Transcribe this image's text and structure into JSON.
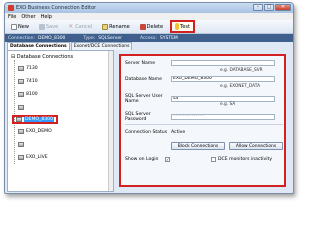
{
  "window": {
    "title": "EXO Business Connection Editor",
    "controls": {
      "minimize": "–",
      "maximize": "□",
      "close": "✕"
    }
  },
  "menu": {
    "items": [
      "File",
      "Other",
      "Help"
    ]
  },
  "toolbar": {
    "new_label": "New",
    "save_label": "Save",
    "cancel_label": "Cancel",
    "rename_label": "Rename",
    "delete_label": "Delete",
    "test_label": "Test"
  },
  "connection_bar": {
    "connection_label": "Connection:",
    "connection_value": "DEMO_8300",
    "type_label": "Type:",
    "type_value": "SQLServer",
    "access_label": "Access:",
    "access_value": "SYSTEM"
  },
  "tabs": [
    "Database Connections",
    "Exonet/DCE Connections"
  ],
  "tree": {
    "root_label": "Database Connections",
    "items": [
      "7130",
      "7410",
      "8100",
      "",
      "DEMO_8300",
      "EXO_DEMO",
      "",
      "EXO_LIVE"
    ],
    "selected_index": 4
  },
  "form": {
    "server_name_label": "Server Name",
    "server_name_value": "",
    "server_name_hint": "e.g. DATABASE_SVR",
    "database_name_label": "Database Name",
    "database_name_value": "EXO_DEMO_8300",
    "database_name_hint": "e.g. EXONET_DATA",
    "sql_user_label": "SQL Server User Name",
    "sql_user_value": "sa",
    "sql_user_hint": "e.g. SA",
    "sql_password_label": "SQL Server Password",
    "sql_password_value": "**************",
    "connection_status_label": "Connection Status",
    "connection_status_value": "Active",
    "block_button_label": "Block Connections",
    "allow_button_label": "Allow Connections",
    "show_on_login_label": "Show on Login",
    "show_on_login_checked": "✓",
    "dce_monitors_label": "DCE monitors inactivity",
    "dce_monitors_checked": ""
  },
  "colors": {
    "highlight_border": "#d32121",
    "connection_bar_bg": "#3f5f8c",
    "selection_bg": "#3399ff"
  }
}
